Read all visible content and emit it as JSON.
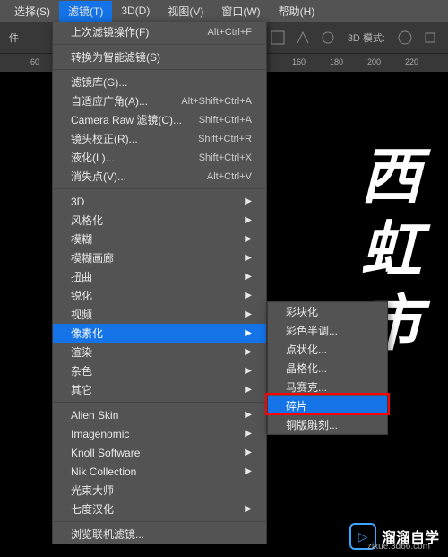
{
  "menubar": {
    "items": [
      {
        "label": "选择(S)",
        "key": "S"
      },
      {
        "label": "滤镜(T)",
        "key": "T",
        "active": true
      },
      {
        "label": "3D(D)",
        "key": "D"
      },
      {
        "label": "视图(V)",
        "key": "V"
      },
      {
        "label": "窗口(W)",
        "key": "W"
      },
      {
        "label": "帮助(H)",
        "key": "H"
      }
    ]
  },
  "toolbar": {
    "mode_label": "3D 模式:"
  },
  "ruler": {
    "ticks": [
      {
        "label": "60",
        "pos": 34
      },
      {
        "label": "160",
        "pos": 326
      },
      {
        "label": "180",
        "pos": 368
      },
      {
        "label": "200",
        "pos": 410
      },
      {
        "label": "220",
        "pos": 452
      }
    ]
  },
  "canvas": {
    "vertical_text": "西虹市"
  },
  "dropdown": {
    "groups": [
      [
        {
          "label": "上次滤镜操作(F)",
          "shortcut": "Alt+Ctrl+F"
        }
      ],
      [
        {
          "label": "转换为智能滤镜(S)"
        }
      ],
      [
        {
          "label": "滤镜库(G)..."
        },
        {
          "label": "自适应广角(A)...",
          "shortcut": "Alt+Shift+Ctrl+A"
        },
        {
          "label": "Camera Raw 滤镜(C)...",
          "shortcut": "Shift+Ctrl+A"
        },
        {
          "label": "镜头校正(R)...",
          "shortcut": "Shift+Ctrl+R"
        },
        {
          "label": "液化(L)...",
          "shortcut": "Shift+Ctrl+X"
        },
        {
          "label": "消失点(V)...",
          "shortcut": "Alt+Ctrl+V"
        }
      ],
      [
        {
          "label": "3D",
          "submenu": true
        },
        {
          "label": "风格化",
          "submenu": true
        },
        {
          "label": "模糊",
          "submenu": true
        },
        {
          "label": "模糊画廊",
          "submenu": true
        },
        {
          "label": "扭曲",
          "submenu": true
        },
        {
          "label": "锐化",
          "submenu": true
        },
        {
          "label": "视频",
          "submenu": true
        },
        {
          "label": "像素化",
          "submenu": true,
          "highlight": true
        },
        {
          "label": "渲染",
          "submenu": true
        },
        {
          "label": "杂色",
          "submenu": true
        },
        {
          "label": "其它",
          "submenu": true
        }
      ],
      [
        {
          "label": "Alien Skin",
          "submenu": true
        },
        {
          "label": "Imagenomic",
          "submenu": true
        },
        {
          "label": "Knoll Software",
          "submenu": true
        },
        {
          "label": "Nik Collection",
          "submenu": true
        },
        {
          "label": "光束大师"
        },
        {
          "label": "七度汉化",
          "submenu": true
        }
      ],
      [
        {
          "label": "浏览联机滤镜..."
        }
      ]
    ]
  },
  "submenu": {
    "items": [
      {
        "label": "彩块化"
      },
      {
        "label": "彩色半调..."
      },
      {
        "label": "点状化..."
      },
      {
        "label": "晶格化..."
      },
      {
        "label": "马赛克..."
      },
      {
        "label": "碎片",
        "highlight": true
      },
      {
        "label": "铜版雕刻..."
      }
    ]
  },
  "watermark": {
    "brand": "溜溜自学",
    "url": "zixue.3d66.com"
  }
}
